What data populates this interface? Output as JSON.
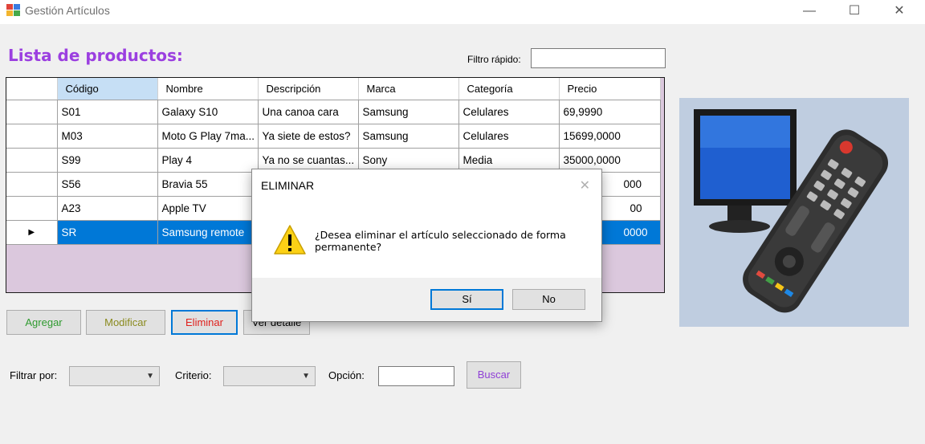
{
  "window": {
    "title": "Gestión Artículos",
    "minimize": "—",
    "maximize": "☐",
    "close": "✕"
  },
  "header": {
    "title": "Lista de productos:",
    "filtro_label": "Filtro rápido:",
    "filtro_value": ""
  },
  "grid": {
    "columns": [
      "Código",
      "Nombre",
      "Descripción",
      "Marca",
      "Categoría",
      "Precio"
    ],
    "rows": [
      {
        "codigo": "S01",
        "nombre": "Galaxy S10",
        "descripcion": "Una canoa cara",
        "marca": "Samsung",
        "categoria": "Celulares",
        "precio": "69,9990"
      },
      {
        "codigo": "M03",
        "nombre": "Moto G Play 7ma...",
        "descripcion": "Ya siete de estos?",
        "marca": "Samsung",
        "categoria": "Celulares",
        "precio": "15699,0000"
      },
      {
        "codigo": "S99",
        "nombre": "Play 4",
        "descripcion": "Ya no se cuantas...",
        "marca": "Sony",
        "categoria": "Media",
        "precio": "35000,0000"
      },
      {
        "codigo": "S56",
        "nombre": "Bravia 55",
        "descripcion": "",
        "marca": "",
        "categoria": "",
        "precio": "000"
      },
      {
        "codigo": "A23",
        "nombre": "Apple TV",
        "descripcion": "",
        "marca": "",
        "categoria": "",
        "precio": "00"
      },
      {
        "codigo": "SR",
        "nombre": "Samsung remote",
        "descripcion": "",
        "marca": "",
        "categoria": "",
        "precio": "0000"
      }
    ],
    "selected_row_marker": "▶"
  },
  "buttons": {
    "agregar": "Agregar",
    "modificar": "Modificar",
    "eliminar": "Eliminar",
    "detalle": "Ver detalle"
  },
  "filters": {
    "filtrar_label": "Filtrar por:",
    "filtrar_value": "",
    "criterio_label": "Criterio:",
    "criterio_value": "",
    "opcion_label": "Opción:",
    "opcion_value": "",
    "buscar": "Buscar"
  },
  "dialog": {
    "title": "ELIMINAR",
    "close": "✕",
    "message": "¿Desea eliminar el artículo seleccionado de forma permanente?",
    "yes": "Sí",
    "no": "No"
  },
  "colors": {
    "accent": "#0078d7",
    "title_purple": "#9b3fe0",
    "grid_background": "#dbc8dd",
    "warning": "#fcd116"
  },
  "icons": [
    "app-icon",
    "minimize-icon",
    "maximize-icon",
    "close-icon",
    "row-pointer-icon",
    "chevron-down-icon",
    "warning-icon",
    "product-image"
  ]
}
